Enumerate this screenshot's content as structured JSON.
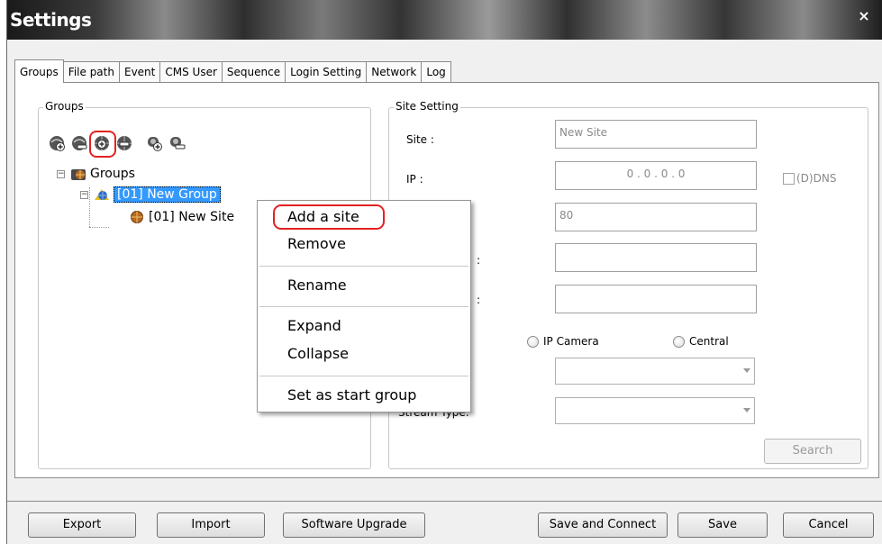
{
  "window": {
    "title": "Settings",
    "close_glyph": "×"
  },
  "tabs": [
    {
      "label": "Groups",
      "active": true
    },
    {
      "label": "File path"
    },
    {
      "label": "Event"
    },
    {
      "label": "CMS User"
    },
    {
      "label": "Sequence"
    },
    {
      "label": "Login Setting"
    },
    {
      "label": "Network"
    },
    {
      "label": "Log"
    }
  ],
  "groups_panel": {
    "title": "Groups",
    "toolbar_icons": [
      "add-group-icon",
      "remove-group-icon",
      "add-site-icon",
      "remove-site-icon",
      "add-camera-icon",
      "remove-camera-icon"
    ],
    "tree": {
      "root": {
        "label": "Groups",
        "expander": "−"
      },
      "group": {
        "label": "[01] New Group",
        "expander": "−"
      },
      "site": {
        "label": "[01] New Site"
      }
    }
  },
  "site_setting": {
    "title": "Site Setting",
    "site_label": "Site :",
    "site_value": "New Site",
    "ip_label": "IP :",
    "ip_value": "0   .   0   .   0   .   0",
    "ddns_label": "(D)DNS",
    "port_value": "80",
    "user_label_partial": ":",
    "password_label_partial": ":",
    "radio_ip_camera": "IP Camera",
    "radio_central": "Central",
    "stream_type_label": "Stream Type:",
    "search_button": "Search"
  },
  "context_menu": {
    "items": [
      "Add a site",
      "Remove",
      "Rename",
      "Expand",
      "Collapse",
      "Set as start group"
    ]
  },
  "footer": {
    "export": "Export",
    "import": "Import",
    "software_upgrade": "Software Upgrade",
    "save_and_connect": "Save and Connect",
    "save": "Save",
    "cancel": "Cancel"
  },
  "colors": {
    "highlight_red": "#e32222",
    "selection_blue": "#3399ff"
  }
}
